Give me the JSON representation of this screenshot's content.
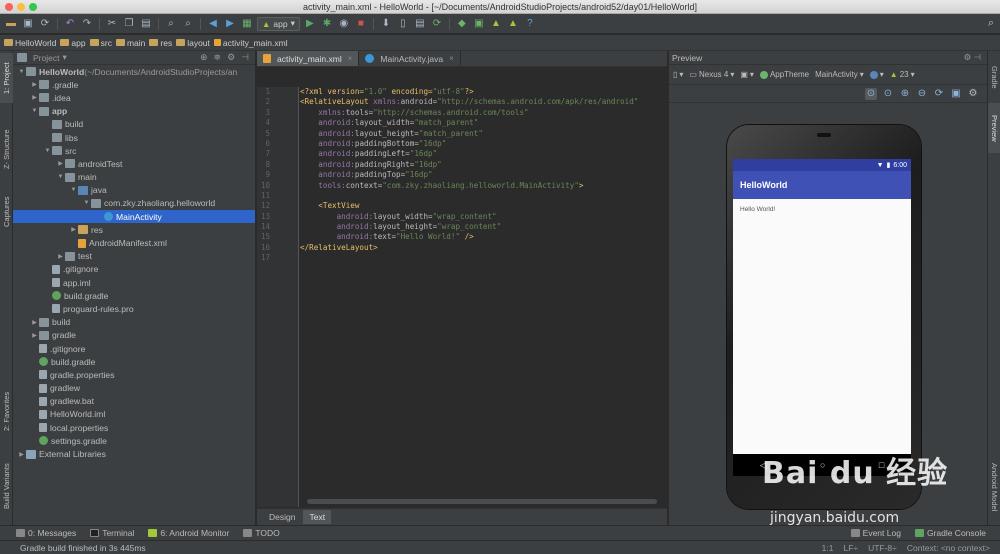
{
  "window": {
    "title": "activity_main.xml - HelloWorld - [~/Documents/AndroidStudioProjects/android52/day01/HelloWorld]"
  },
  "toolbar": {
    "run_config": "app"
  },
  "breadcrumb": [
    "HelloWorld",
    "app",
    "src",
    "main",
    "res",
    "layout",
    "activity_main.xml"
  ],
  "left_tabs": [
    "1: Project",
    "Z- Structure",
    "Captures",
    "2: Favorites",
    "Build Variants"
  ],
  "right_tabs": [
    "Gradle",
    "Preview",
    "Android Model"
  ],
  "project": {
    "view_label": "Project",
    "tree": [
      {
        "depth": 0,
        "arrow": "▼",
        "icon": "folder",
        "label": "HelloWorld",
        "extra": " (~/Documents/AndroidStudioProjects/an",
        "bold": true
      },
      {
        "depth": 1,
        "arrow": "▶",
        "icon": "folder",
        "label": ".gradle"
      },
      {
        "depth": 1,
        "arrow": "▶",
        "icon": "folder",
        "label": ".idea"
      },
      {
        "depth": 1,
        "arrow": "▼",
        "icon": "folder",
        "label": "app",
        "bold": true
      },
      {
        "depth": 2,
        "arrow": "",
        "icon": "folder",
        "label": "build"
      },
      {
        "depth": 2,
        "arrow": "",
        "icon": "folder",
        "label": "libs"
      },
      {
        "depth": 2,
        "arrow": "▼",
        "icon": "folder",
        "label": "src"
      },
      {
        "depth": 3,
        "arrow": "▶",
        "icon": "folder",
        "label": "androidTest"
      },
      {
        "depth": 3,
        "arrow": "▼",
        "icon": "folder",
        "label": "main"
      },
      {
        "depth": 4,
        "arrow": "▼",
        "icon": "blue",
        "label": "java"
      },
      {
        "depth": 5,
        "arrow": "▼",
        "icon": "folder",
        "label": "com.zky.zhaoliang.helloworld"
      },
      {
        "depth": 6,
        "arrow": "",
        "icon": "java",
        "label": "MainActivity"
      },
      {
        "depth": 4,
        "arrow": "▶",
        "icon": "yellow",
        "label": "res"
      },
      {
        "depth": 4,
        "arrow": "",
        "icon": "xml",
        "label": "AndroidManifest.xml"
      },
      {
        "depth": 3,
        "arrow": "▶",
        "icon": "folder",
        "label": "test"
      },
      {
        "depth": 2,
        "arrow": "",
        "icon": "file",
        "label": ".gitignore"
      },
      {
        "depth": 2,
        "arrow": "",
        "icon": "file",
        "label": "app.iml"
      },
      {
        "depth": 2,
        "arrow": "",
        "icon": "gradle",
        "label": "build.gradle"
      },
      {
        "depth": 2,
        "arrow": "",
        "icon": "file",
        "label": "proguard-rules.pro"
      },
      {
        "depth": 1,
        "arrow": "▶",
        "icon": "folder",
        "label": "build"
      },
      {
        "depth": 1,
        "arrow": "▶",
        "icon": "folder",
        "label": "gradle"
      },
      {
        "depth": 1,
        "arrow": "",
        "icon": "file",
        "label": ".gitignore"
      },
      {
        "depth": 1,
        "arrow": "",
        "icon": "gradle",
        "label": "build.gradle"
      },
      {
        "depth": 1,
        "arrow": "",
        "icon": "file",
        "label": "gradle.properties"
      },
      {
        "depth": 1,
        "arrow": "",
        "icon": "file",
        "label": "gradlew"
      },
      {
        "depth": 1,
        "arrow": "",
        "icon": "file",
        "label": "gradlew.bat"
      },
      {
        "depth": 1,
        "arrow": "",
        "icon": "file",
        "label": "HelloWorld.iml"
      },
      {
        "depth": 1,
        "arrow": "",
        "icon": "file",
        "label": "local.properties"
      },
      {
        "depth": 1,
        "arrow": "",
        "icon": "gradle",
        "label": "settings.gradle"
      },
      {
        "depth": 0,
        "arrow": "▶",
        "icon": "lib",
        "label": "External Libraries"
      }
    ]
  },
  "editor": {
    "tabs": [
      "activity_main.xml",
      "MainActivity.java"
    ],
    "active_tab": 0,
    "lines": [
      [
        [
          "pi",
          "<?xml version="
        ],
        [
          "val",
          "\"1.0\""
        ],
        [
          "pi",
          " encoding="
        ],
        [
          "val",
          "\"utf-8\""
        ],
        [
          "pi",
          "?>"
        ]
      ],
      [
        [
          "tag",
          "<RelativeLayout "
        ],
        [
          "attr",
          "xmlns:"
        ],
        [
          "an",
          "android="
        ],
        [
          "val",
          "\"http://schemas.android.com/apk/res/android\""
        ]
      ],
      [
        [
          "an",
          "    "
        ],
        [
          "attr",
          "xmlns:"
        ],
        [
          "an",
          "tools="
        ],
        [
          "val",
          "\"http://schemas.android.com/tools\""
        ]
      ],
      [
        [
          "an",
          "    "
        ],
        [
          "attr",
          "android:"
        ],
        [
          "an",
          "layout_width="
        ],
        [
          "val",
          "\"match_parent\""
        ]
      ],
      [
        [
          "an",
          "    "
        ],
        [
          "attr",
          "android:"
        ],
        [
          "an",
          "layout_height="
        ],
        [
          "val",
          "\"match_parent\""
        ]
      ],
      [
        [
          "an",
          "    "
        ],
        [
          "attr",
          "android:"
        ],
        [
          "an",
          "paddingBottom="
        ],
        [
          "val",
          "\"16dp\""
        ]
      ],
      [
        [
          "an",
          "    "
        ],
        [
          "attr",
          "android:"
        ],
        [
          "an",
          "paddingLeft="
        ],
        [
          "val",
          "\"16dp\""
        ]
      ],
      [
        [
          "an",
          "    "
        ],
        [
          "attr",
          "android:"
        ],
        [
          "an",
          "paddingRight="
        ],
        [
          "val",
          "\"16dp\""
        ]
      ],
      [
        [
          "an",
          "    "
        ],
        [
          "attr",
          "android:"
        ],
        [
          "an",
          "paddingTop="
        ],
        [
          "val",
          "\"16dp\""
        ]
      ],
      [
        [
          "an",
          "    "
        ],
        [
          "attr",
          "tools:"
        ],
        [
          "an",
          "context="
        ],
        [
          "val",
          "\"com.zky.zhaoliang.helloworld.MainActivity\""
        ],
        [
          "tag",
          ">"
        ]
      ],
      [],
      [
        [
          "an",
          "    "
        ],
        [
          "tag",
          "<TextView"
        ]
      ],
      [
        [
          "an",
          "        "
        ],
        [
          "attr",
          "android:"
        ],
        [
          "an",
          "layout_width="
        ],
        [
          "val",
          "\"wrap_content\""
        ]
      ],
      [
        [
          "an",
          "        "
        ],
        [
          "attr",
          "android:"
        ],
        [
          "an",
          "layout_height="
        ],
        [
          "val",
          "\"wrap_content\""
        ]
      ],
      [
        [
          "an",
          "        "
        ],
        [
          "attr",
          "android:"
        ],
        [
          "an",
          "text="
        ],
        [
          "val",
          "\"Hello World!\""
        ],
        [
          "tag",
          " />"
        ]
      ],
      [
        [
          "tag",
          "</RelativeLayout>"
        ]
      ],
      []
    ],
    "bottom_tabs": [
      "Design",
      "Text"
    ],
    "active_bottom_tab": 1
  },
  "preview": {
    "header": "Preview",
    "device": "Nexus 4",
    "theme": "AppTheme",
    "activity": "MainActivity",
    "api": "23",
    "clock": "6:00",
    "app_title": "HelloWorld",
    "content_text": "Hello World!"
  },
  "bottom_tools": {
    "messages": "0: Messages",
    "terminal": "Terminal",
    "monitor": "6: Android Monitor",
    "todo": "TODO",
    "event_log": "Event Log",
    "gradle_console": "Gradle Console"
  },
  "status": {
    "message": "Gradle build finished in 3s 445ms",
    "position": "1:1",
    "line_sep": "LF÷",
    "encoding": "UTF-8÷",
    "context": "Context: <no context>"
  },
  "watermark": {
    "brand": "Bai du 经验",
    "url": "jingyan.baidu.com"
  },
  "colors": {
    "selection": "#2f65ca",
    "app_bar": "#3f51b5",
    "status_bar": "#303f9f",
    "xml_tag": "#e8bf6a",
    "xml_value": "#6a8759",
    "xml_attr": "#9876aa"
  }
}
